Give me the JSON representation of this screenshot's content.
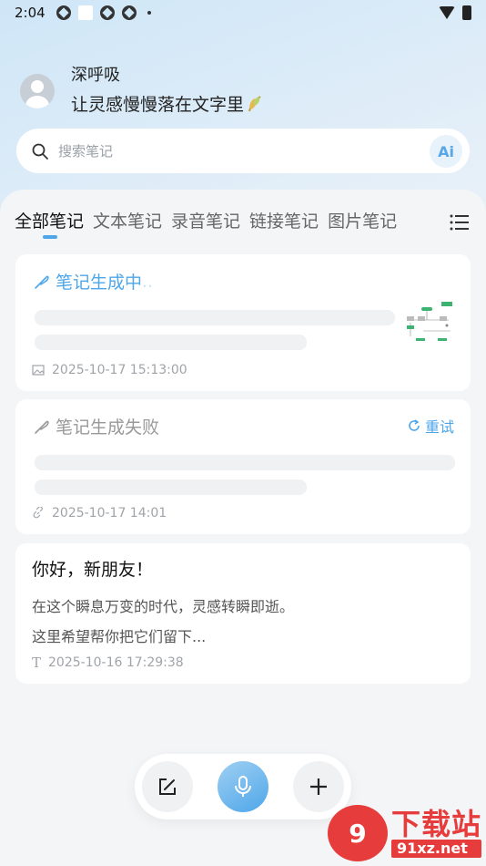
{
  "status_bar": {
    "time": "2:04"
  },
  "profile": {
    "name": "深呼吸",
    "motto": "让灵感慢慢落在文字里"
  },
  "search": {
    "placeholder": "搜索笔记",
    "ai_label": "Ai"
  },
  "tabs": [
    {
      "label": "全部笔记",
      "active": true
    },
    {
      "label": "文本笔记",
      "active": false
    },
    {
      "label": "录音笔记",
      "active": false
    },
    {
      "label": "链接笔记",
      "active": false
    },
    {
      "label": "图片笔记",
      "active": false
    }
  ],
  "notes": [
    {
      "title": "笔记生成中",
      "title_suffix": " ..",
      "timestamp": "2025-10-17 15:13:00",
      "type_icon": "image-icon",
      "status": "generating"
    },
    {
      "title": "笔记生成失败",
      "retry_label": "重试",
      "timestamp": "2025-10-17 14:01",
      "type_icon": "link-icon",
      "status": "failed"
    },
    {
      "title": "你好，新朋友！",
      "line1": "在这个瞬息万变的时代，灵感转瞬即逝。",
      "line2": "这里希望帮你把它们留下...",
      "type_icon_glyph": "T",
      "timestamp": "2025-10-16 17:29:38",
      "status": "done"
    }
  ],
  "bottom_bar": {
    "buttons": [
      "edit-icon",
      "mic-icon",
      "plus-icon"
    ]
  },
  "watermark": {
    "big": "下载站",
    "small": "91xz.net",
    "logo": "9"
  },
  "colors": {
    "accent": "#4ea6e9",
    "watermark_red": "#e73c3c"
  }
}
